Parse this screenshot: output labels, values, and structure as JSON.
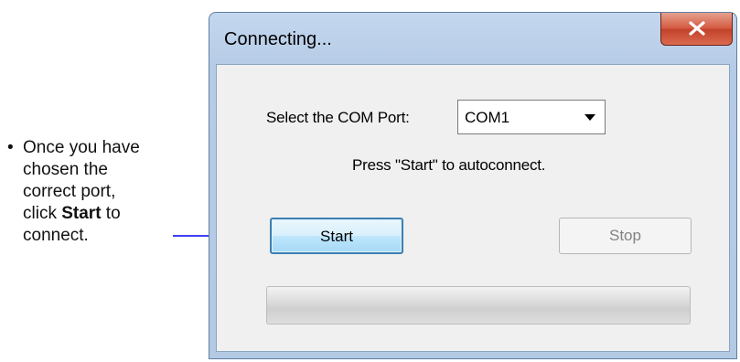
{
  "annotation": {
    "bullet": "•",
    "line1": "Once you have",
    "line2": "chosen the",
    "line3": "correct port,",
    "line4_pre": "click ",
    "line4_bold": "Start",
    "line4_post": " to",
    "line5": "connect."
  },
  "dialog": {
    "title": "Connecting...",
    "com_label": "Select the COM Port:",
    "com_value": "COM1",
    "hint": "Press \"Start\" to autoconnect.",
    "start_label": "Start",
    "stop_label": "Stop",
    "progress": 0
  },
  "colors": {
    "arrow": "#0000ee",
    "close_button": "#c9442c",
    "start_border": "#3c7fb1"
  },
  "icons": {
    "close": "close-icon",
    "dropdown": "chevron-down-icon",
    "arrow": "arrow-right-icon"
  }
}
